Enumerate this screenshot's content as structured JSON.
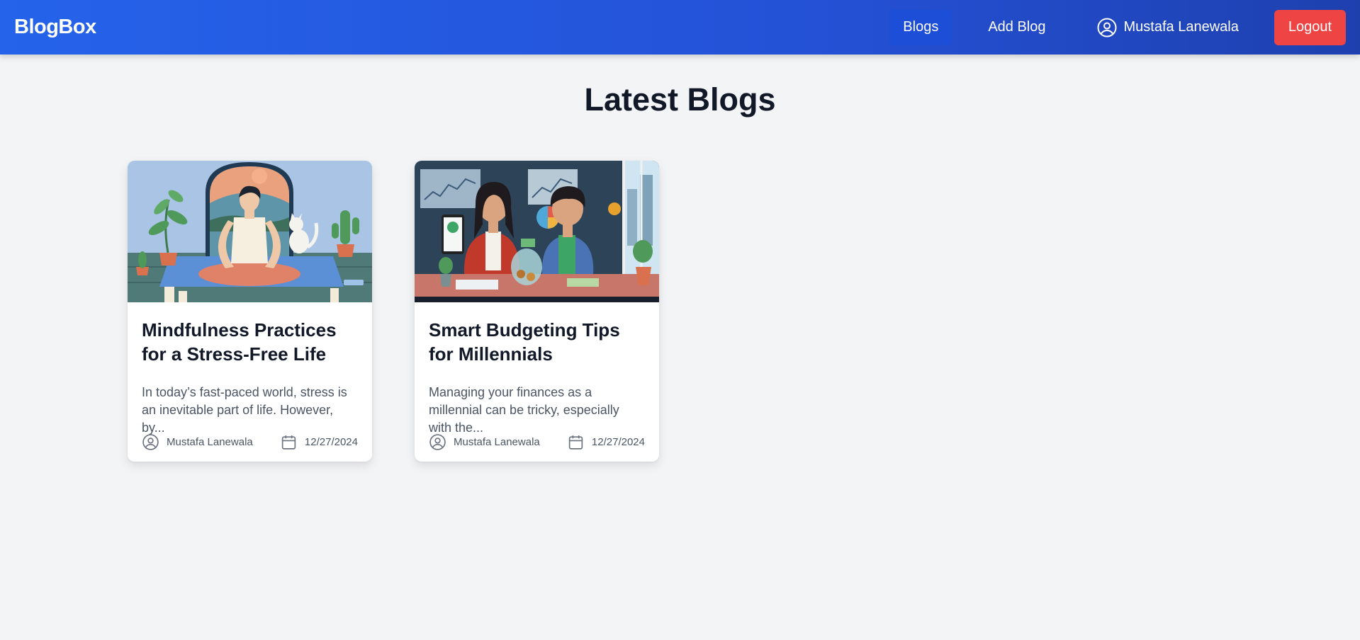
{
  "nav": {
    "brand": "BlogBox",
    "links": [
      {
        "label": "Blogs",
        "active": true
      },
      {
        "label": "Add Blog",
        "active": false
      }
    ],
    "user_name": "Mustafa Lanewala",
    "user_icon": "user-circle-icon",
    "logout_label": "Logout"
  },
  "main": {
    "title": "Latest Blogs"
  },
  "blogs": [
    {
      "title": "Mindfulness Practices for a Stress-Free Life",
      "excerpt": "In today’s fast-paced world, stress is an inevitable part of life. However, by...",
      "author": "Mustafa Lanewala",
      "date": "12/27/2024",
      "image": "meditation-illustration"
    },
    {
      "title": "Smart Budgeting Tips for Millennials",
      "excerpt": "Managing your finances as a millennial can be tricky, especially with the...",
      "author": "Mustafa Lanewala",
      "date": "12/27/2024",
      "image": "budgeting-illustration"
    }
  ],
  "colors": {
    "nav_gradient_start": "#2563eb",
    "nav_gradient_end": "#1e40af",
    "active_link": "#1d4ed8",
    "logout": "#ef4444",
    "page_bg": "#f3f4f6"
  }
}
